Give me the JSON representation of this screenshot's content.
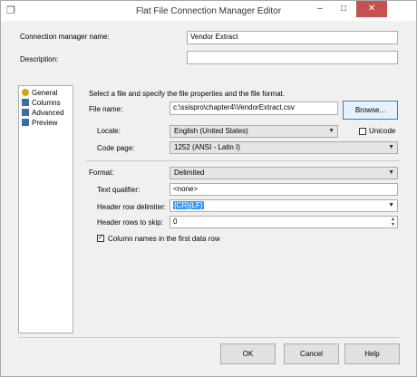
{
  "window": {
    "title": "Flat File Connection Manager Editor",
    "minimize": "–",
    "maximize": "□",
    "close": "✕"
  },
  "connection_manager_name": {
    "label": "Connection manager name:",
    "value": "Vendor Extract"
  },
  "description": {
    "label": "Description:",
    "value": ""
  },
  "nav": {
    "items": [
      {
        "label": "General",
        "icon": "general-icon",
        "color": "#d4a017"
      },
      {
        "label": "Columns",
        "icon": "columns-icon",
        "color": "#3a6ea5"
      },
      {
        "label": "Advanced",
        "icon": "advanced-icon",
        "color": "#3a6ea5"
      },
      {
        "label": "Preview",
        "icon": "preview-icon",
        "color": "#3a6ea5"
      }
    ]
  },
  "general": {
    "instruction": "Select a file and specify the file properties and the file format.",
    "file_name_label": "File name:",
    "file_name_value": "c:\\ssispro\\chapter4\\VendorExtract.csv",
    "browse_label": "Browse...",
    "locale_label": "Locale:",
    "locale_value": "English (United States)",
    "unicode_label": "Unicode",
    "code_page_label": "Code page:",
    "code_page_value": "1252  (ANSI - Latin I)",
    "format_label": "Format:",
    "format_value": "Delimited",
    "text_qualifier_label": "Text qualifier:",
    "text_qualifier_value": "<none>",
    "header_row_delimiter_label": "Header row delimiter:",
    "header_row_delimiter_value": "{CR}{LF}",
    "header_rows_to_skip_label": "Header rows to skip:",
    "header_rows_to_skip_value": "0",
    "column_names_label": "Column names in the first data row",
    "column_names_checked": true
  },
  "footer": {
    "ok": "OK",
    "cancel": "Cancel",
    "help": "Help"
  }
}
